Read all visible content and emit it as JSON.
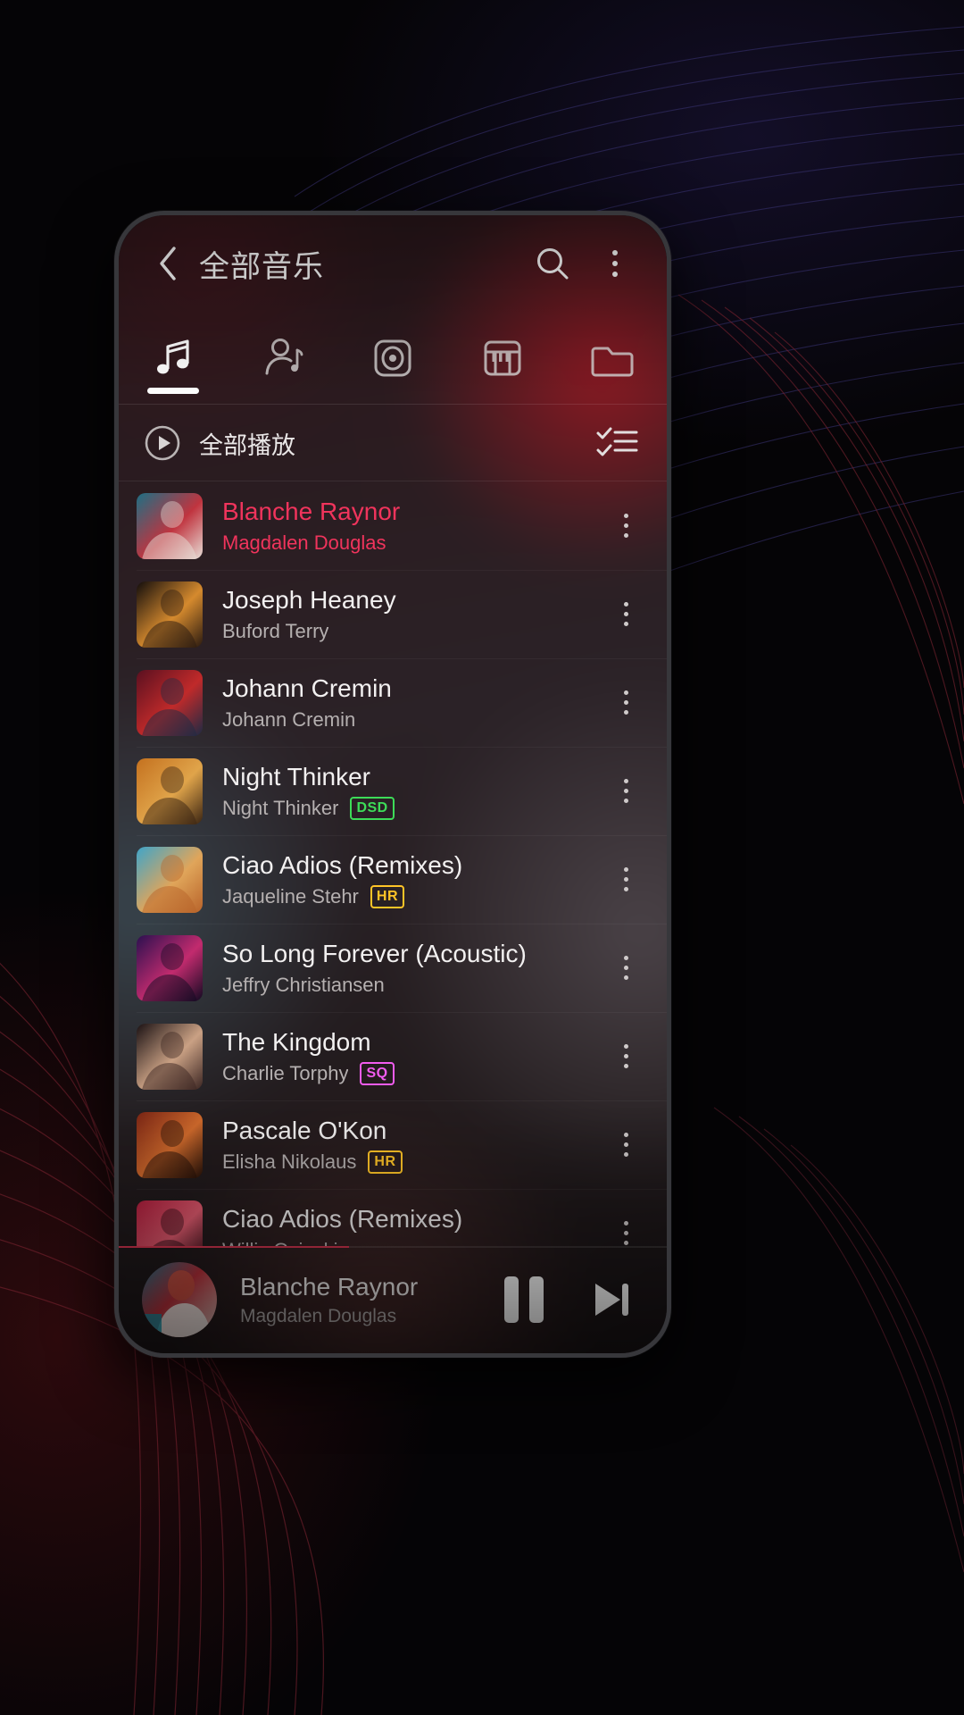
{
  "header": {
    "title": "全部音乐",
    "back_icon": "chevron-left-icon",
    "search_icon": "search-icon",
    "overflow_icon": "kebab-menu-icon"
  },
  "tabs": [
    {
      "id": "songs",
      "icon": "music-note-icon",
      "active": true
    },
    {
      "id": "artists",
      "icon": "artist-icon",
      "active": false
    },
    {
      "id": "albums",
      "icon": "album-disc-icon",
      "active": false
    },
    {
      "id": "genres",
      "icon": "piano-keys-icon",
      "active": false
    },
    {
      "id": "folders",
      "icon": "folder-icon",
      "active": false
    }
  ],
  "play_all": {
    "label": "全部播放",
    "play_icon": "play-circle-icon",
    "multiselect_icon": "checklist-icon"
  },
  "songs": [
    {
      "title": "Blanche Raynor",
      "artist": "Magdalen Douglas",
      "badge": "",
      "playing": true,
      "art": "a1"
    },
    {
      "title": "Joseph Heaney",
      "artist": "Buford Terry",
      "badge": "",
      "playing": false,
      "art": "a2"
    },
    {
      "title": "Johann Cremin",
      "artist": "Johann Cremin",
      "badge": "",
      "playing": false,
      "art": "a3"
    },
    {
      "title": "Night Thinker",
      "artist": "Night Thinker",
      "badge": "DSD",
      "playing": false,
      "art": "a4"
    },
    {
      "title": "Ciao Adios (Remixes)",
      "artist": "Jaqueline Stehr",
      "badge": "HR",
      "playing": false,
      "art": "a5"
    },
    {
      "title": "So Long Forever (Acoustic)",
      "artist": "Jeffry Christiansen",
      "badge": "",
      "playing": false,
      "art": "a6"
    },
    {
      "title": "The Kingdom",
      "artist": "Charlie Torphy",
      "badge": "SQ",
      "playing": false,
      "art": "a7"
    },
    {
      "title": "Pascale O'Kon",
      "artist": "Elisha Nikolaus",
      "badge": "HR",
      "playing": false,
      "art": "a8"
    },
    {
      "title": "Ciao Adios (Remixes)",
      "artist": "Willis Osinski",
      "badge": "",
      "playing": false,
      "art": "a9"
    }
  ],
  "now_playing": {
    "title": "Blanche Raynor",
    "artist": "Magdalen Douglas",
    "pause_icon": "pause-icon",
    "next_icon": "next-track-icon"
  },
  "colors": {
    "accent": "#f0345c",
    "badge_dsd": "#3ddc58",
    "badge_hr": "#ffc427",
    "badge_sq": "#f25cf0",
    "text_primary": "#f2f0f0",
    "text_secondary": "#b5b0b0"
  }
}
